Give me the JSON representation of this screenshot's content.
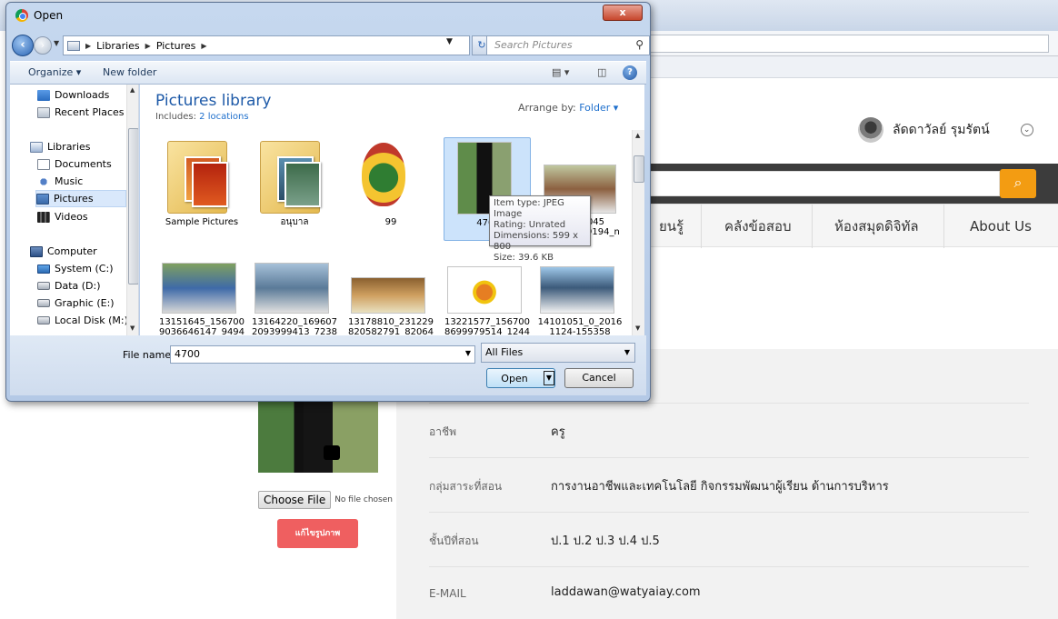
{
  "page": {
    "user_name": "ลัดดาวัลย์ รุมรัตน์",
    "nav": [
      "ยนรู้",
      "คลังข้อสอบ",
      "ห้องสมุดดิจิทัล",
      "About Us"
    ],
    "choose_file_label": "Choose File",
    "no_file_text": "No file chosen",
    "change_photo_label": "แก้ไขรูปภาพ",
    "info": [
      {
        "label": "อาชีพ",
        "value": "ครู"
      },
      {
        "label": "กลุ่มสาระที่สอน",
        "value": "การงานอาชีพและเทคโนโลยี กิจกรรมพัฒนาผู้เรียน ด้านการบริหาร"
      },
      {
        "label": "ชั้นปีที่สอน",
        "value": "ป.1 ป.2 ป.3 ป.4 ป.5"
      },
      {
        "label": "E-MAIL",
        "value": "laddawan@watyaiay.com"
      }
    ]
  },
  "dialog": {
    "title": "Open",
    "close_label": "x",
    "breadcrumb": [
      "Libraries",
      "Pictures"
    ],
    "search_placeholder": "Search Pictures",
    "toolbar": {
      "organize": "Organize",
      "new_folder": "New folder"
    },
    "nav_pane": [
      {
        "label": "Downloads",
        "icon": "downloads-icon"
      },
      {
        "label": "Recent Places",
        "icon": "recent-places-icon"
      },
      {
        "label": "Libraries",
        "icon": "libraries-icon"
      },
      {
        "label": "Documents",
        "icon": "documents-icon"
      },
      {
        "label": "Music",
        "icon": "music-icon"
      },
      {
        "label": "Pictures",
        "icon": "pictures-icon",
        "selected": true
      },
      {
        "label": "Videos",
        "icon": "videos-icon"
      },
      {
        "label": "Computer",
        "icon": "computer-icon"
      },
      {
        "label": "System (C:)",
        "icon": "system-drive-icon"
      },
      {
        "label": "Data (D:)",
        "icon": "drive-icon"
      },
      {
        "label": "Graphic (E:)",
        "icon": "drive-icon"
      },
      {
        "label": "Local Disk (M:)",
        "icon": "drive-icon"
      }
    ],
    "library_title": "Pictures library",
    "includes_label": "Includes:",
    "includes_link": "2 locations",
    "arrange_label": "Arrange by:",
    "arrange_value": "Folder",
    "items": [
      {
        "name": "Sample Pictures",
        "kind": "folder"
      },
      {
        "name": "อนุบาล",
        "kind": "folder"
      },
      {
        "name": "99",
        "kind": "image"
      },
      {
        "name": "4700",
        "kind": "image",
        "selected": true
      },
      {
        "name": "8909 1045 074322439194_n",
        "kind": "image"
      },
      {
        "name": "13151645_156700 9036646147_9494",
        "kind": "image"
      },
      {
        "name": "13164220_169607 2093999413_7238",
        "kind": "image"
      },
      {
        "name": "13178810_231229 820582791_82064",
        "kind": "image"
      },
      {
        "name": "13221577_156700 8699979514_1244",
        "kind": "image"
      },
      {
        "name": "14101051_0_2016 1124-155358",
        "kind": "image"
      }
    ],
    "tooltip": [
      "Item type: JPEG Image",
      "Rating: Unrated",
      "Dimensions: 599 x 800",
      "Size: 39.6 KB"
    ],
    "file_name_label": "File name:",
    "file_name_value": "4700",
    "filter_value": "All Files",
    "open_label": "Open",
    "cancel_label": "Cancel"
  }
}
